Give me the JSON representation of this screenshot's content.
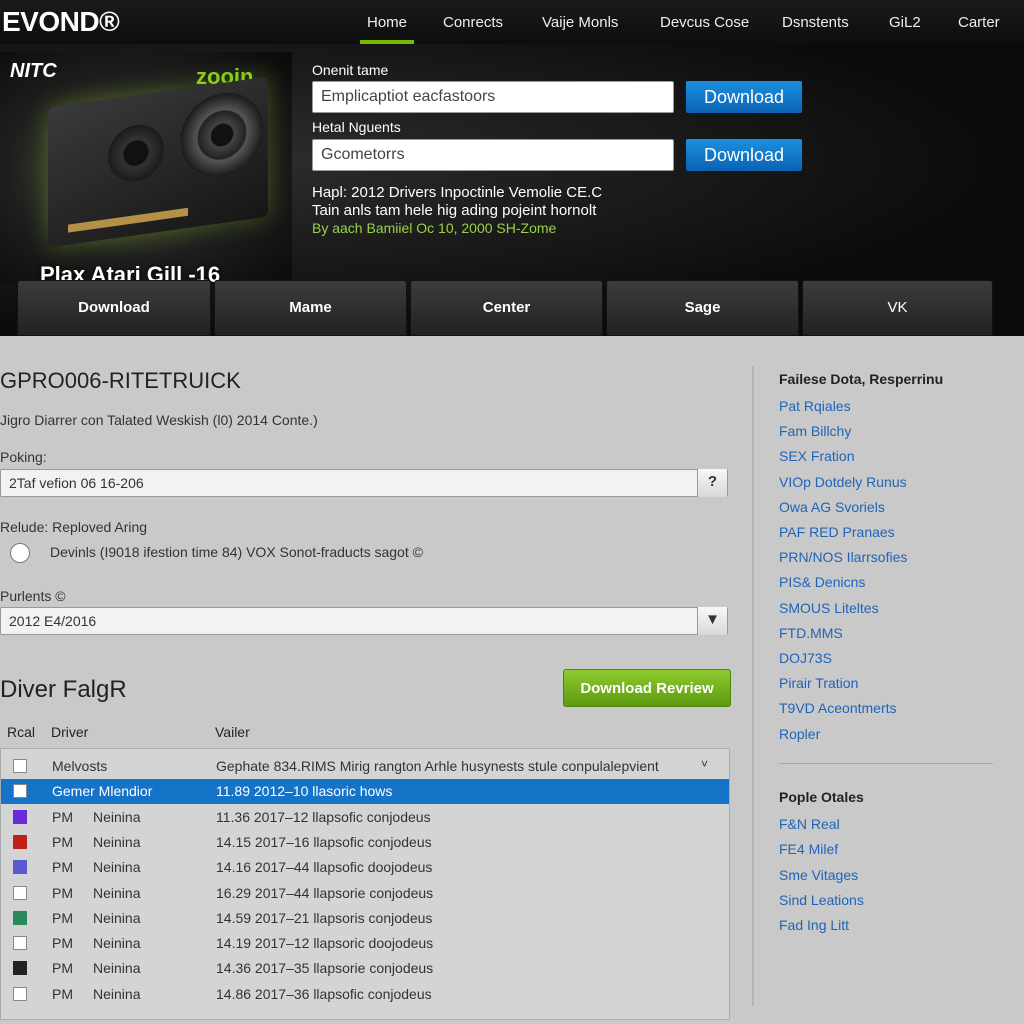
{
  "header": {
    "logo": "EVOND®",
    "nav": [
      "Home",
      "Conrects",
      "Vaije Monls",
      "Devcus Cose",
      "Dsnstents",
      "GiL2",
      "Carter"
    ]
  },
  "hero": {
    "brand": "NITC",
    "zoom": "zooin",
    "caption": "Plax Atari Gill -16",
    "field1_label": "Onenit tame",
    "field1_value": "Emplicaptiot eacfastoors",
    "field2_label": "Hetal Nguents",
    "field2_value": "Gcometorrs",
    "download_label": "Download",
    "info_line1": "Hapl: 2012 Drivers Inpoctinle Vemolie CE.C",
    "info_line2": "Tain anls tam hele hig ading pojeint hornolt",
    "info_line3": "By aach Bamiiel Oc 10, 2000 SH-Zome",
    "tabs": [
      "Download",
      "Mame",
      "Center",
      "Sage",
      "VK"
    ]
  },
  "main": {
    "title": "GPRO006-RITETRUICK",
    "subline": "Jigro Diarrer con Talated Weskish (l0) 2014 Conte.)",
    "poking_label": "Poking:",
    "poking_value": "2Taf vefion 06 16-206",
    "help_glyph": "?",
    "relude_label": "Relude: Reploved Aring",
    "radio_text": "Devinls (I9018 ifestion time 84) VOX Sonot-fraducts sagot ©",
    "purlents_label": "Purlents ©",
    "purlents_value": "2012 E4/2016",
    "dropdown_glyph": "▼",
    "driver_heading": "Diver FalgR",
    "download_review": "Download Revriew",
    "columns": [
      "Rcal",
      "Driver",
      "Vailer"
    ],
    "rows": [
      {
        "c1": "",
        "c2": "Melvosts",
        "c3": "Gephate 834.RIMS Mirig rangton Arhle husynests stule conpulalepvient",
        "swatch": "#ffffff",
        "selected": false
      },
      {
        "c1": "",
        "c2": "Gemer Mlendior",
        "c3": "11.89 2012–10 llasoric hows",
        "swatch": "#ffffff",
        "selected": true
      },
      {
        "c1": "PM",
        "c2": "Neinina",
        "c3": "11.36 2017–12 llapsofic conjodeus",
        "swatch": "#6a2ad8",
        "selected": false
      },
      {
        "c1": "PM",
        "c2": "Neinina",
        "c3": "14.15 2017–16 llapsofic conjodeus",
        "swatch": "#c0201a",
        "selected": false
      },
      {
        "c1": "PM",
        "c2": "Neinina",
        "c3": "14.16 2017–44 llapsofic doojodeus",
        "swatch": "#5a5ad0",
        "selected": false
      },
      {
        "c1": "PM",
        "c2": "Neinina",
        "c3": "16.29 2017–44 llapsorie conjodeus",
        "swatch": "#ffffff",
        "selected": false
      },
      {
        "c1": "PM",
        "c2": "Neinina",
        "c3": "14.59 2017–21 llapsoris conjodeus",
        "swatch": "#2a8a5a",
        "selected": false
      },
      {
        "c1": "PM",
        "c2": "Neinina",
        "c3": "14.19 2017–12 llapsoric doojodeus",
        "swatch": "#ffffff",
        "selected": false
      },
      {
        "c1": "PM",
        "c2": "Neinina",
        "c3": "14.36 2017–35 llapsorie conjodeus",
        "swatch": "#222222",
        "selected": false
      },
      {
        "c1": "PM",
        "c2": "Neinina",
        "c3": "14.86 2017–36 llapsofic conjodeus",
        "swatch": "#ffffff",
        "selected": false
      }
    ]
  },
  "sidebar": {
    "section1_title": "Failese Dota, Resperrinu",
    "section1_links": [
      "Pat Rqiales",
      "Fam Billchy",
      "SEX Fration",
      "VIOp Dotdely Runus",
      "Owa AG Svoriels",
      "PAF RED Pranaes",
      "PRN/NOS Ilarrsofies",
      "PIS& Denicns",
      "SMOUS Liteltes",
      "FTD.MMS",
      "DOJ73S",
      "Pirair Tration",
      "T9VD Aceontmerts",
      "Ropler"
    ],
    "section2_title": "Pople Otales",
    "section2_links": [
      "F&N Real",
      "FE4 Milef",
      "Sme Vitages",
      "Sind Leations",
      "Fad Ing Litt"
    ]
  }
}
